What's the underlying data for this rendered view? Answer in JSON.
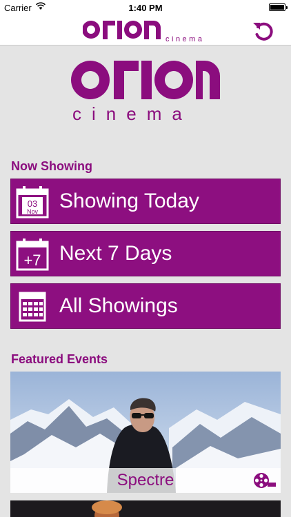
{
  "status_bar": {
    "carrier": "Carrier",
    "time": "1:40 PM"
  },
  "brand": {
    "name": "orion",
    "subtitle": "cinema",
    "color": "#8b0d7e"
  },
  "now_showing": {
    "title": "Now Showing",
    "buttons": [
      {
        "label": "Showing Today",
        "icon": "calendar-today-icon",
        "icon_day": "03",
        "icon_month": "Nov"
      },
      {
        "label": "Next 7 Days",
        "icon": "calendar-plus7-icon",
        "icon_text": "+7"
      },
      {
        "label": "All Showings",
        "icon": "calendar-grid-icon"
      }
    ]
  },
  "featured": {
    "title": "Featured Events",
    "events": [
      {
        "title": "Spectre",
        "icon": "film-reel-icon"
      }
    ]
  }
}
